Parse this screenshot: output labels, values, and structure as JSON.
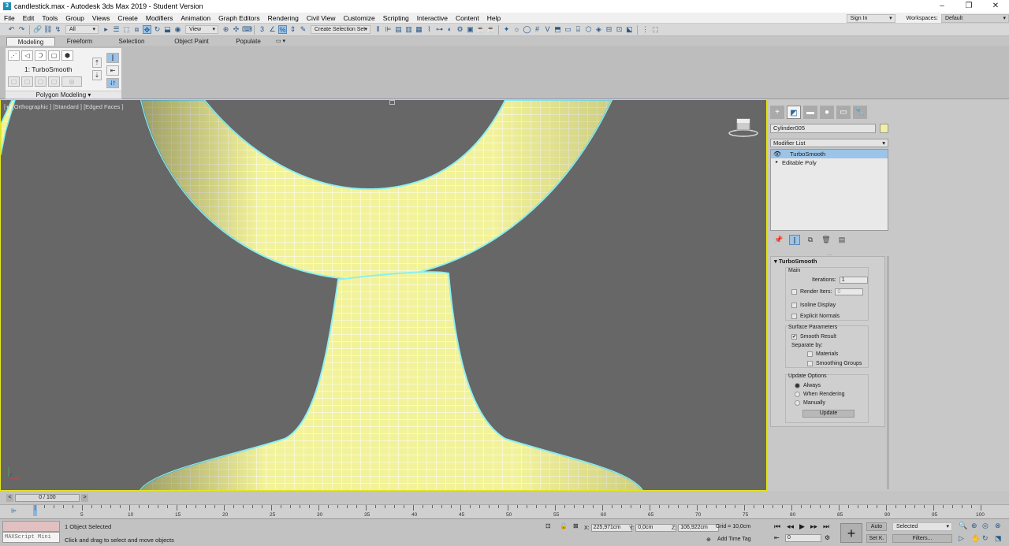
{
  "window": {
    "title": "candlestick.max - Autodesk 3ds Max 2019 - Student Version",
    "app_icon": "3",
    "min": "–",
    "max": "❐",
    "close": "✕"
  },
  "menu": [
    "File",
    "Edit",
    "Tools",
    "Group",
    "Views",
    "Create",
    "Modifiers",
    "Animation",
    "Graph Editors",
    "Rendering",
    "Civil View",
    "Customize",
    "Scripting",
    "Interactive",
    "Content",
    "Help"
  ],
  "account": {
    "signin": "Sign In",
    "workspaces_label": "Workspaces:",
    "workspace_value": "Default"
  },
  "toolbar": {
    "filter_value": "All",
    "refcoord_value": "View",
    "selection_set": "Create Selection Set"
  },
  "ribbon": {
    "tabs": [
      "Modeling",
      "Freeform",
      "Selection",
      "Object Paint",
      "Populate"
    ],
    "active_tab": "Modeling",
    "stack_label": "1: TurboSmooth",
    "panel_label": "Polygon Modeling"
  },
  "viewport": {
    "label": "[+] [Orthographic ] [Standard ] [Edged Faces ]"
  },
  "command_panel": {
    "object_name": "Cylinder005",
    "object_color": "#f0f0a0",
    "modifier_list": "Modifier List",
    "stack": [
      {
        "label": "TurboSmooth",
        "selected": true
      },
      {
        "label": "Editable Poly",
        "selected": false
      }
    ],
    "rollout": {
      "title": "TurboSmooth",
      "main_label": "Main",
      "iterations_label": "Iterations:",
      "iterations_value": "1",
      "render_iters_label": "Render Iters:",
      "render_iters_value": "0",
      "isoline": "Isoline Display",
      "explicit_normals": "Explicit Normals",
      "surface_params": "Surface Parameters",
      "smooth_result": "Smooth Result",
      "separate_by": "Separate by:",
      "materials": "Materials",
      "smoothing_groups": "Smoothing Groups",
      "update_options": "Update Options",
      "always": "Always",
      "when_rendering": "When Rendering",
      "manually": "Manually",
      "update_button": "Update"
    }
  },
  "timeline": {
    "slider_text": "0 / 100",
    "ticks": [
      "5",
      "10",
      "15",
      "20",
      "25",
      "30",
      "35",
      "40",
      "45",
      "50",
      "55",
      "60",
      "65",
      "70",
      "75",
      "80",
      "85",
      "90",
      "95",
      "100"
    ]
  },
  "status": {
    "maxscript": "MAXScript Mini",
    "selected": "1 Object Selected",
    "hint": "Click and drag to select and move objects",
    "x_label": "X:",
    "x": "225,971cm",
    "y_label": "Y:",
    "y": "0,0cm",
    "z_label": "Z:",
    "z": "106,922cm",
    "grid": "Grid = 10,0cm",
    "add_time_tag": "Add Time Tag",
    "auto": "Auto",
    "setk": "Set K.",
    "selected_dd": "Selected",
    "filters": "Filters...",
    "frame": "0"
  }
}
